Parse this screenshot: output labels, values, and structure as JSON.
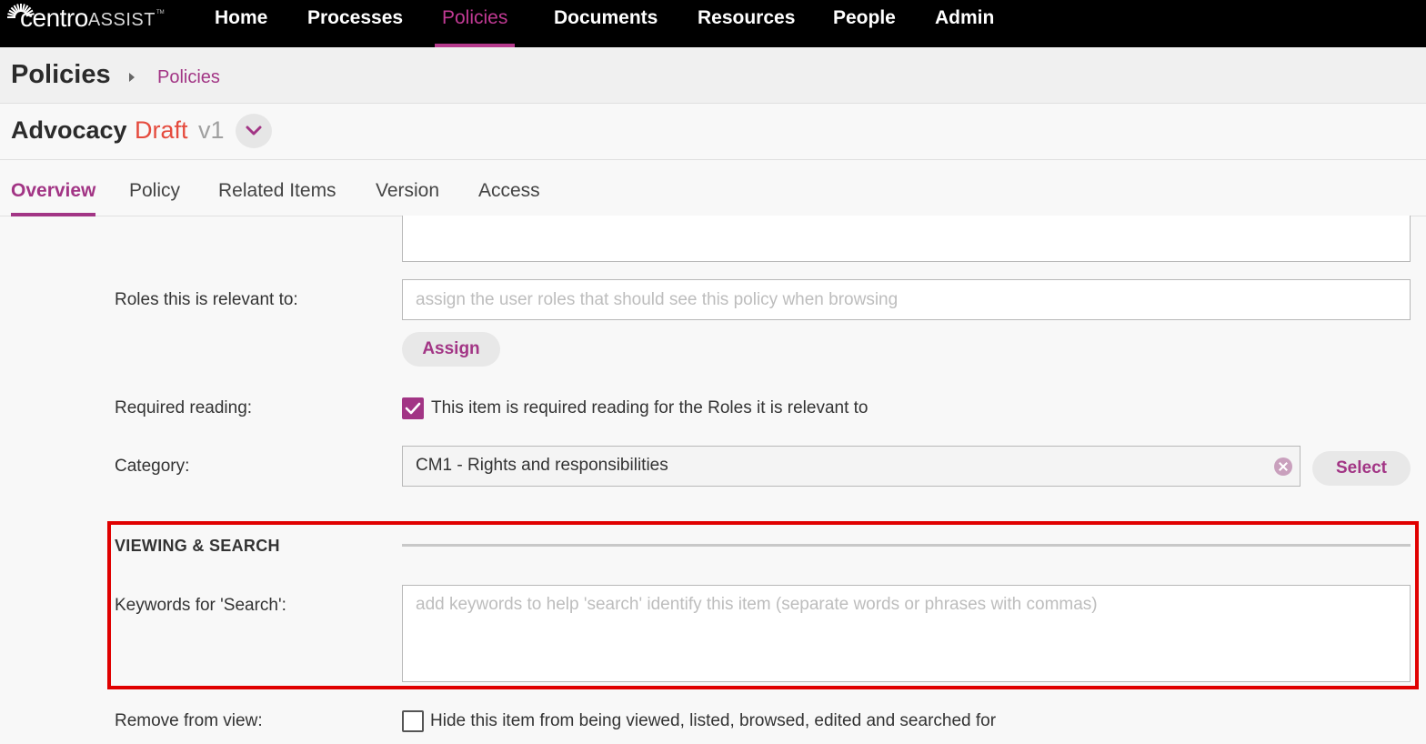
{
  "nav": {
    "logo_main": "centro",
    "logo_sub": "ASSIST",
    "logo_tm": "TM",
    "items": [
      {
        "label": "Home"
      },
      {
        "label": "Processes"
      },
      {
        "label": "Policies"
      },
      {
        "label": "Documents"
      },
      {
        "label": "Resources"
      },
      {
        "label": "People"
      },
      {
        "label": "Admin"
      }
    ],
    "active": "Policies"
  },
  "breadcrumb": {
    "title": "Policies",
    "link": "Policies"
  },
  "item": {
    "title": "Advocacy",
    "status": "Draft",
    "version": "v1",
    "dropdown_icon": "chevron-down-icon"
  },
  "tabs": [
    {
      "label": "Overview"
    },
    {
      "label": "Policy"
    },
    {
      "label": "Related Items"
    },
    {
      "label": "Version"
    },
    {
      "label": "Access"
    }
  ],
  "form": {
    "roles": {
      "label": "Roles this is relevant to:",
      "placeholder": "assign the user roles that should see this policy when browsing",
      "button": "Assign"
    },
    "required_reading": {
      "label": "Required reading:",
      "checkbox_label": "This item is required reading for the Roles it is relevant to",
      "checked": true
    },
    "category": {
      "label": "Category:",
      "value": "CM1 - Rights and responsibilities",
      "button": "Select"
    },
    "section": {
      "heading": "VIEWING & SEARCH"
    },
    "keywords": {
      "label": "Keywords for 'Search':",
      "placeholder": "add keywords to help 'search' identify this item (separate words or phrases with commas)"
    },
    "remove": {
      "label": "Remove from view:",
      "checkbox_label": "Hide this item from being viewed, listed, browsed, edited and searched for",
      "checked": false
    }
  },
  "colors": {
    "accent": "#a23585",
    "draft": "#e54b3e",
    "highlight": "#e00000"
  }
}
